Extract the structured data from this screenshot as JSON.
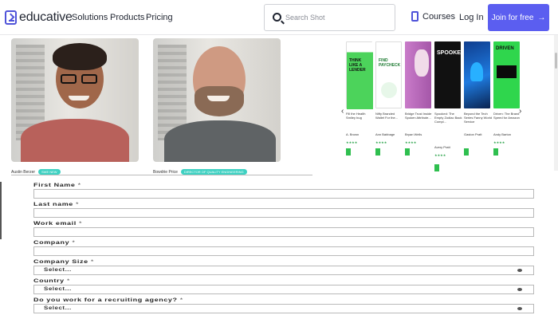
{
  "nav": {
    "logo_text": "educative",
    "links": [
      "Solutions",
      "Products",
      "Pricing"
    ],
    "search_placeholder": "Search Shot",
    "courses_label": "Courses",
    "login_label": "Log In",
    "join_label": "Join for free",
    "accent_color": "#5b5ef0"
  },
  "people": [
    {
      "name": "Austin Berzer",
      "badge": "SWE NEW"
    },
    {
      "name": "Bowdrie Price",
      "badge": "DIRECTOR OF QUALITY ENGINEERING"
    }
  ],
  "books": [
    {
      "cover_title": "THINK LIKE A LENDER",
      "subtitle": "Fill the Health Smiley bug",
      "author": "A. Brown"
    },
    {
      "cover_title": "FIND PAYCHECK",
      "subtitle": "Nifty Branded Wallet For the...",
      "author": "Ann Babbage"
    },
    {
      "cover_title": "",
      "subtitle": "Bridge Trust Inside Spoken Attribute...",
      "author": "Bryan Wells"
    },
    {
      "cover_title": "SPOOKED",
      "subtitle": "Spooked: The Empty Zodiac Back Compl...",
      "author": "Avery Pratt"
    },
    {
      "cover_title": "",
      "subtitle": "Beyond the Tech Series Fanny World Service",
      "author": "Gaston Pratt"
    },
    {
      "cover_title": "DRIVEN",
      "subtitle": "Driven: The Brand Speed for Amazon",
      "author": "Andy Barton"
    }
  ],
  "form": {
    "fields": [
      {
        "label": "First Name",
        "required_mark": "*"
      },
      {
        "label": "Last name",
        "required_mark": "*"
      },
      {
        "label": "Work email",
        "required_mark": "*"
      },
      {
        "label": "Company",
        "required_mark": "*"
      }
    ],
    "selects": [
      {
        "label": "Company Size",
        "required_mark": "*",
        "value": "Select..."
      },
      {
        "label": "Country",
        "required_mark": "*",
        "value": "Select..."
      },
      {
        "label": "Do you work for a recruiting agency?",
        "required_mark": "*",
        "value": "Select..."
      }
    ]
  }
}
